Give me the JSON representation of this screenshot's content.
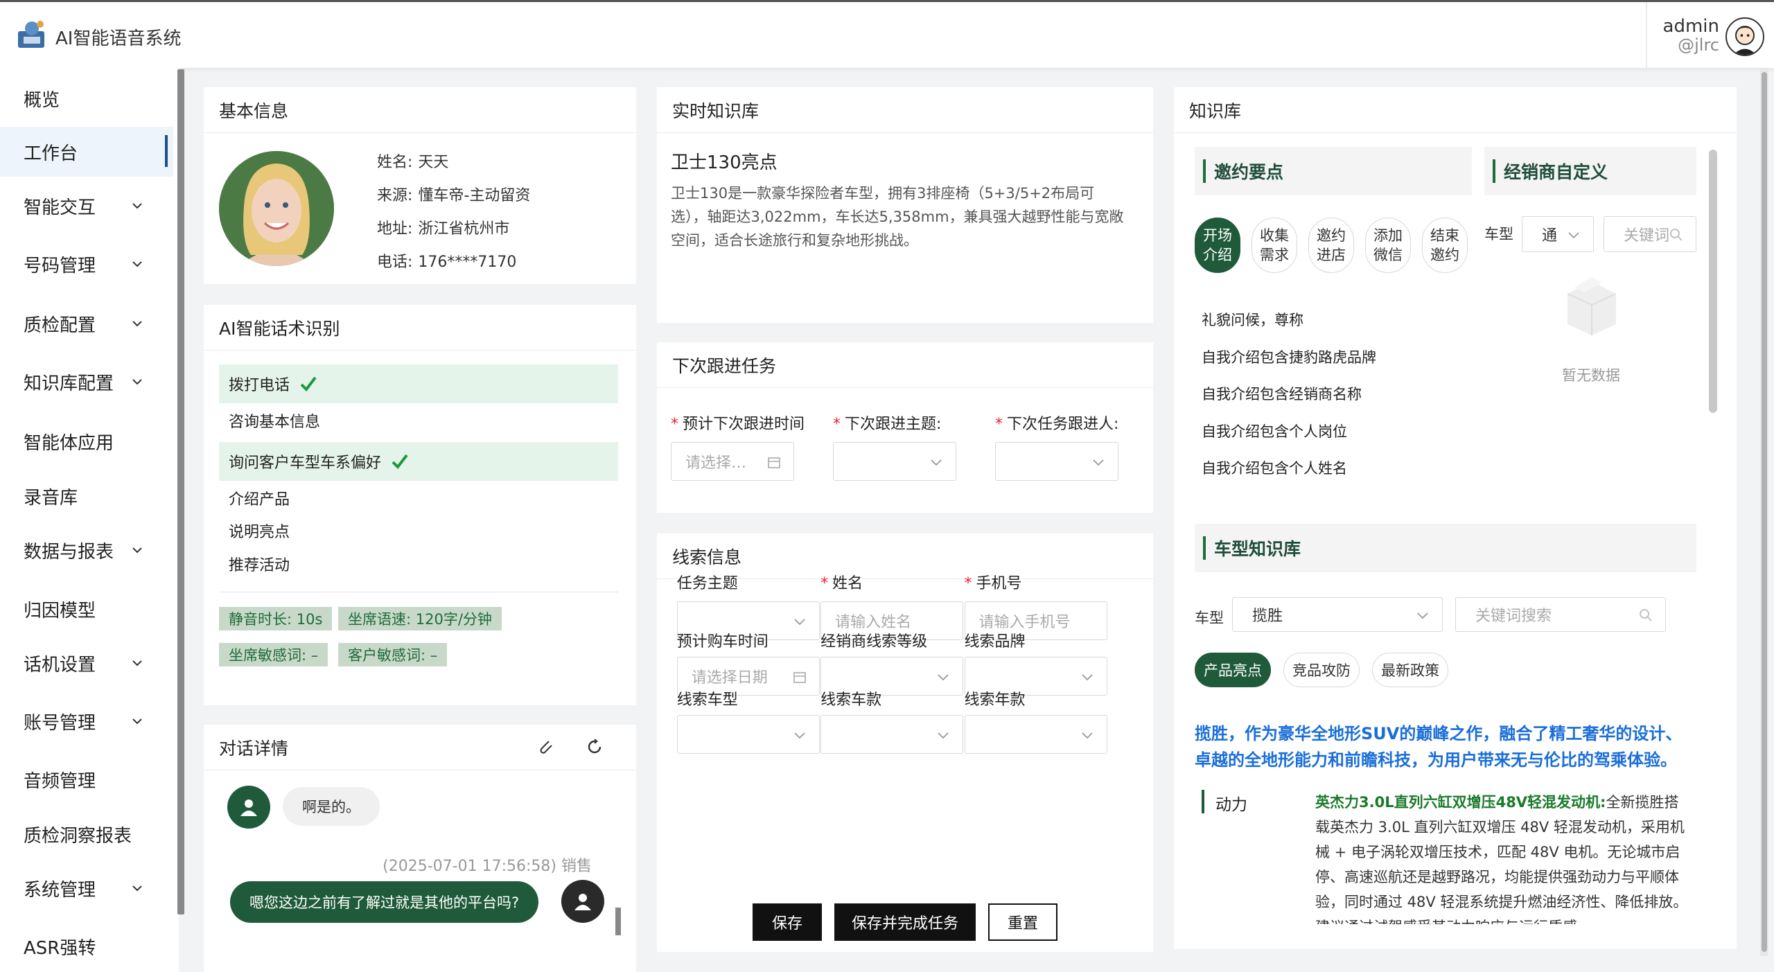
{
  "header": {
    "app_title": "AI智能语音系统",
    "user_name": "admin",
    "user_handle": "@jlrc"
  },
  "sidebar": {
    "items": [
      {
        "label": "概览",
        "expandable": false
      },
      {
        "label": "工作台",
        "expandable": false,
        "active": true
      },
      {
        "label": "智能交互",
        "expandable": true
      },
      {
        "label": "号码管理",
        "expandable": true
      },
      {
        "label": "质检配置",
        "expandable": true
      },
      {
        "label": "知识库配置",
        "expandable": true
      },
      {
        "label": "智能体应用",
        "expandable": false
      },
      {
        "label": "录音库",
        "expandable": false
      },
      {
        "label": "数据与报表",
        "expandable": true
      },
      {
        "label": "归因模型",
        "expandable": false
      },
      {
        "label": "话机设置",
        "expandable": true
      },
      {
        "label": "账号管理",
        "expandable": true
      },
      {
        "label": "音频管理",
        "expandable": false
      },
      {
        "label": "质检洞察报表",
        "expandable": false
      },
      {
        "label": "系统管理",
        "expandable": true
      },
      {
        "label": "ASR强转",
        "expandable": false
      }
    ]
  },
  "basic_info": {
    "title": "基本信息",
    "rows": [
      {
        "label": "姓名:",
        "value": "天天"
      },
      {
        "label": "来源:",
        "value": "懂车帝-主动留资"
      },
      {
        "label": "地址:",
        "value": "浙江省杭州市"
      },
      {
        "label": "电话:",
        "value": "176****7170"
      }
    ]
  },
  "ai_recognition": {
    "title": "AI智能话术识别",
    "steps": [
      {
        "label": "拨打电话",
        "done": true
      },
      {
        "label": "咨询基本信息",
        "done": false
      },
      {
        "label": "询问客户车型车系偏好",
        "done": true
      },
      {
        "label": "介绍产品",
        "done": false
      },
      {
        "label": "说明亮点",
        "done": false
      },
      {
        "label": "推荐活动",
        "done": false
      }
    ],
    "tags": [
      "静音时长: 10s",
      "坐席语速: 120字/分钟",
      "坐席敏感词: –",
      "客户敏感词: –"
    ]
  },
  "chat": {
    "title": "对话详情",
    "messages": [
      {
        "text": "啊是的。"
      },
      {
        "meta": "(2025-07-01 17:56:58) 销售",
        "text": "嗯您这边之前有了解过就是其他的平台吗?"
      }
    ]
  },
  "realtime_kb": {
    "title": "实时知识库",
    "heading": "卫士130亮点",
    "body": "卫士130是一款豪华探险者车型，拥有3排座椅（5+3/5+2布局可选），轴距达3,022mm，车长达5,358mm，兼具强大越野性能与宽敞空间，适合长途旅行和复杂地形挑战。"
  },
  "next_task": {
    "title": "下次跟进任务",
    "fields": [
      {
        "label": "预计下次跟进时间",
        "placeholder": "请选择…"
      },
      {
        "label": "下次跟进主题:",
        "placeholder": ""
      },
      {
        "label": "下次任务跟进人:",
        "placeholder": ""
      }
    ]
  },
  "lead_info": {
    "title": "线索信息",
    "fields": [
      {
        "label": "任务主题",
        "required": false,
        "placeholder": ""
      },
      {
        "label": "姓名",
        "required": true,
        "placeholder": "请输入姓名"
      },
      {
        "label": "手机号",
        "required": true,
        "placeholder": "请输入手机号"
      },
      {
        "label": "预计购车时间",
        "required": false,
        "placeholder": "请选择日期"
      },
      {
        "label": "经销商线索等级",
        "required": false,
        "placeholder": ""
      },
      {
        "label": "线索品牌",
        "required": false,
        "placeholder": ""
      },
      {
        "label": "线索车型",
        "required": false,
        "placeholder": ""
      },
      {
        "label": "线索车款",
        "required": false,
        "placeholder": ""
      },
      {
        "label": "线索年款",
        "required": false,
        "placeholder": ""
      }
    ],
    "buttons": {
      "save": "保存",
      "save_complete": "保存并完成任务",
      "reset": "重置"
    }
  },
  "knowledge": {
    "title": "知识库",
    "invite_head": "邀约要点",
    "dealer_head": "经销商自定义",
    "steps": [
      "开场介绍",
      "收集需求",
      "邀约进店",
      "添加微信",
      "结束邀约"
    ],
    "points": [
      "礼貌问候，尊称",
      "自我介绍包含捷豹路虎品牌",
      "自我介绍包含经销商名称",
      "自我介绍包含个人岗位",
      "自我介绍包含个人姓名"
    ],
    "dealer_car_label": "车型",
    "dealer_car_value": "通",
    "dealer_search_placeholder": "关键词",
    "empty_text": "暂无数据",
    "model_head": "车型知识库",
    "model_car_label": "车型",
    "model_car_value": "揽胜",
    "model_search_placeholder": "关键词搜索",
    "tabs": [
      "产品亮点",
      "竞品攻防",
      "最新政策"
    ],
    "highlight": "揽胜，作为豪华全地形SUV的巅峰之作，融合了精工奢华的设计、卓越的全地形能力和前瞻科技，为用户带来无与伦比的驾乘体验。",
    "feature_label": "动力",
    "feature_title": "英杰力3.0L直列六缸双增压48V轻混发动机:",
    "feature_body": "全新揽胜搭载英杰力 3.0L 直列六缸双增压 48V 轻混发动机，采用机械 + 电子涡轮双增压技术，匹配 48V 电机。无论城市启停、高速巡航还是越野路况，均能提供强劲动力与平顺体验，同时通过 48V 轻混系统提升燃油经济性、降低排放。建议通过试驾感受其动力响应与运行质感"
  },
  "colors": {
    "brand_green": "#1f5b3a",
    "link_blue": "#1a6ed8",
    "done_bg": "#e5f4ea",
    "button_dark": "#111111"
  }
}
